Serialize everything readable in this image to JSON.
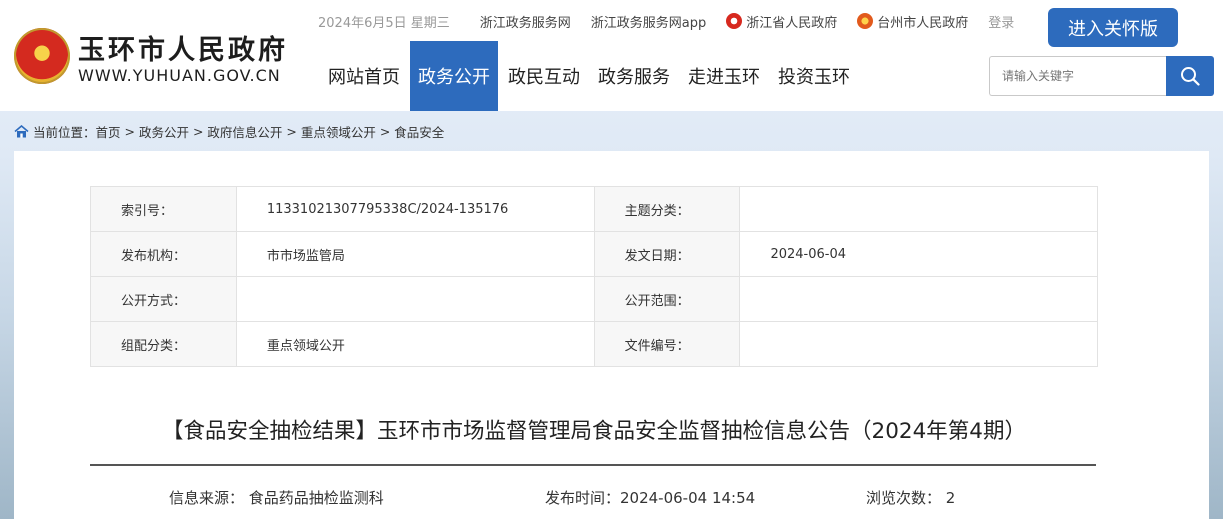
{
  "header": {
    "site_name": "玉环市人民政府",
    "site_domain": "WWW.YUHUAN.GOV.CN",
    "date": "2024年6月5日 星期三",
    "top_links": [
      "浙江政务服务网",
      "浙江政务服务网app",
      "浙江省人民政府",
      "台州市人民政府"
    ],
    "login": "登录",
    "care_button": "进入关怀版",
    "nav": [
      "网站首页",
      "政务公开",
      "政民互动",
      "政务服务",
      "走进玉环",
      "投资玉环"
    ],
    "active_nav": "政务公开",
    "search_placeholder": "请输入关键字",
    "accent_color": "#2d6bbd"
  },
  "breadcrumb": {
    "prefix": "当前位置：",
    "items": [
      "首页",
      "政务公开",
      "政府信息公开",
      "重点领域公开",
      "食品安全"
    ],
    "separator": " > "
  },
  "meta": {
    "index_label": "索引号：",
    "index_value": "11331021307795338C/2024-135176",
    "topic_label": "主题分类：",
    "topic_value": "",
    "org_label": "发布机构：",
    "org_value": "市市场监管局",
    "date_label": "发文日期：",
    "date_value": "2024-06-04",
    "mode_label": "公开方式：",
    "mode_value": "",
    "scope_label": "公开范围：",
    "scope_value": "",
    "group_label": "组配分类：",
    "group_value": "重点领域公开",
    "docno_label": "文件编号：",
    "docno_value": ""
  },
  "article": {
    "title": "【食品安全抽检结果】玉环市市场监督管理局食品安全监督抽检信息公告（2024年第4期）",
    "source": "信息来源： 食品药品抽检监测科",
    "published": "发布时间：2024-06-04 14:54",
    "views": "浏览次数： 2"
  }
}
